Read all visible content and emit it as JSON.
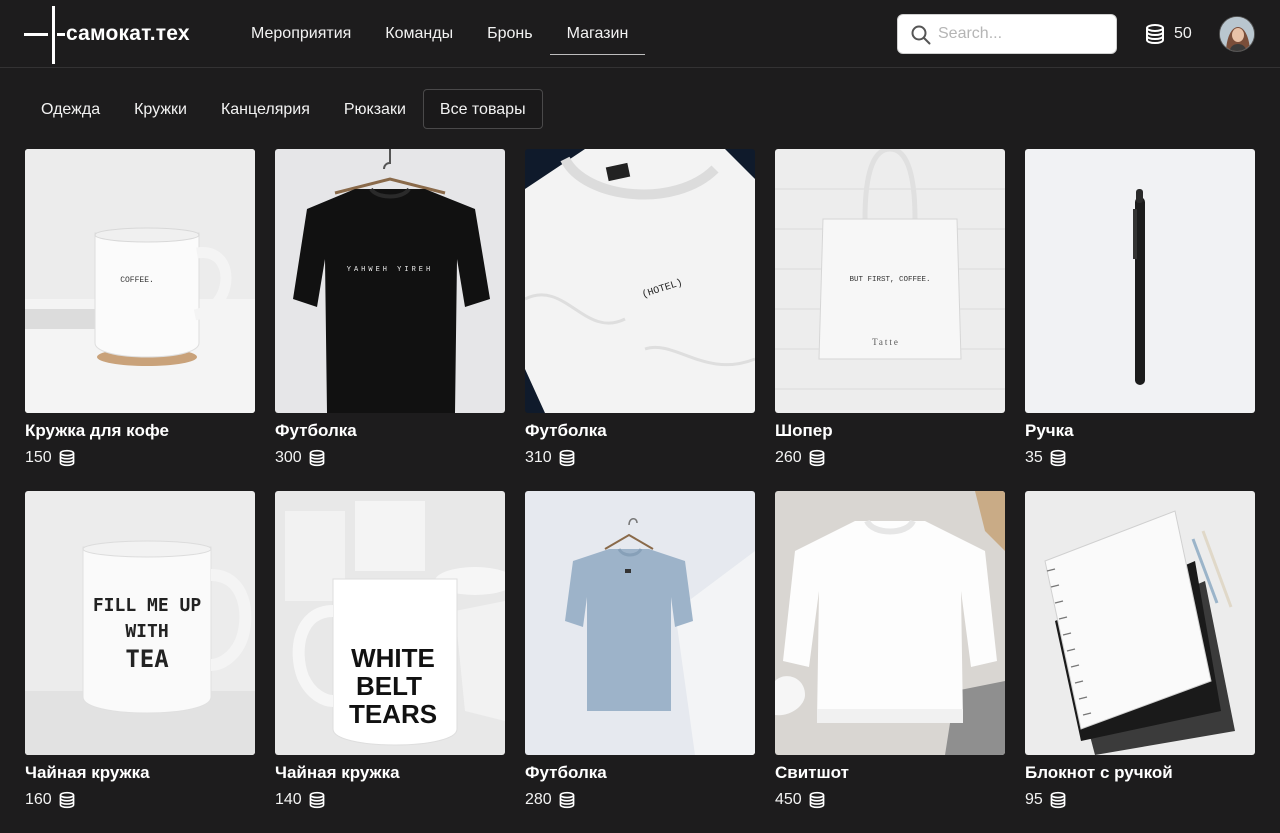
{
  "header": {
    "logo_text": "самокат.тех",
    "nav": [
      {
        "label": "Мероприятия"
      },
      {
        "label": "Команды"
      },
      {
        "label": "Бронь"
      },
      {
        "label": "Магазин"
      }
    ],
    "active_nav": "Магазин",
    "search": {
      "placeholder": "Search...",
      "value": ""
    },
    "balance": "50",
    "avatar_icon": "user-avatar-icon"
  },
  "categories": [
    {
      "label": "Одежда"
    },
    {
      "label": "Кружки"
    },
    {
      "label": "Канцелярия"
    },
    {
      "label": "Рюкзаки"
    },
    {
      "label": "Все товары"
    }
  ],
  "active_category": "Все товары",
  "products": [
    {
      "title": "Кружка для кофе",
      "price": "150",
      "print": "COFFEE."
    },
    {
      "title": "Футболка",
      "price": "300",
      "print": "YAHWEH YIREH"
    },
    {
      "title": "Футболка",
      "price": "310",
      "print": "(HOTEL)"
    },
    {
      "title": "Шопер",
      "price": "260",
      "print": "BUT FIRST, COFFEE."
    },
    {
      "title": "Ручка",
      "price": "35"
    },
    {
      "title": "Чайная кружка",
      "price": "160",
      "print": "FILL ME UP WITH TEA"
    },
    {
      "title": "Чайная кружка",
      "price": "140",
      "print": "WHITE BELT TEARS"
    },
    {
      "title": "Футболка",
      "price": "280"
    },
    {
      "title": "Свитшот",
      "price": "450"
    },
    {
      "title": "Блокнот с ручкой",
      "price": "95"
    }
  ],
  "icons": {
    "coin": "coins-icon",
    "search": "search-icon"
  },
  "colors": {
    "background": "#1d1c1d",
    "text": "#ffffff",
    "search_bg": "#ffffff"
  }
}
